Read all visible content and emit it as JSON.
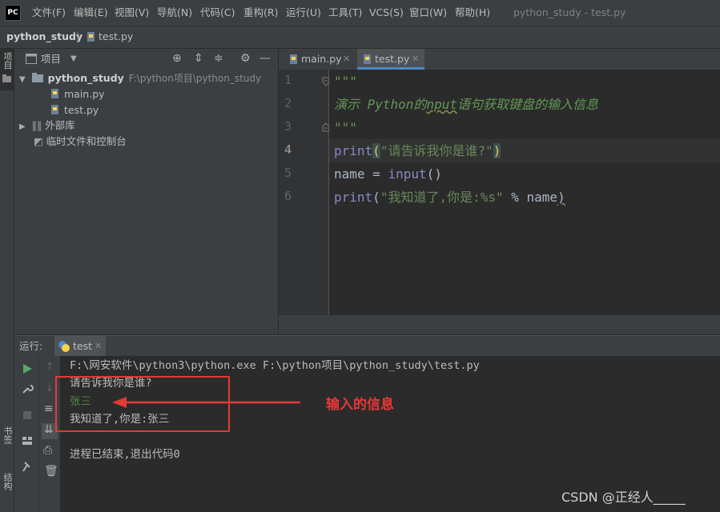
{
  "window": {
    "title": "python_study - test.py",
    "logo": "PC"
  },
  "menu": [
    "文件(F)",
    "编辑(E)",
    "视图(V)",
    "导航(N)",
    "代码(C)",
    "重构(R)",
    "运行(U)",
    "工具(T)",
    "VCS(S)",
    "窗口(W)",
    "帮助(H)"
  ],
  "breadcrumb": {
    "project": "python_study",
    "sep": "〉",
    "file": "test.py"
  },
  "sidebar_left": {
    "project_label": "项目",
    "bookmarks_label": "书签",
    "structure_label": "结构"
  },
  "project_panel": {
    "title": "项目",
    "tree": {
      "root": {
        "name": "python_study",
        "path": "F:\\python项目\\python_study"
      },
      "files": [
        "main.py",
        "test.py"
      ],
      "external_libs": "外部库",
      "scratches": "临时文件和控制台"
    }
  },
  "editor": {
    "tabs": [
      {
        "label": "main.py",
        "active": false
      },
      {
        "label": "test.py",
        "active": true
      }
    ],
    "line_numbers": [
      "1",
      "2",
      "3",
      "4",
      "5",
      "6"
    ],
    "lines": {
      "l1": "\"\"\"",
      "l2_a": "演示 ",
      "l2_b": "Python",
      "l2_c": "的",
      "l2_d": "nput",
      "l2_e": "语句获取键盘的输入信息",
      "l3": "\"\"\"",
      "l4_fn": "print",
      "l4_p1": "(",
      "l4_str": "\"请告诉我你是谁?\"",
      "l4_p2": ")",
      "l5_a": "name = ",
      "l5_fn": "input",
      "l5_b": "()",
      "l6_fn": "print",
      "l6_p1": "(",
      "l6_str": "\"我知道了,你是:%s\"",
      "l6_b": " % name",
      "l6_p2": ")"
    }
  },
  "run_panel": {
    "label": "运行:",
    "tab": "test",
    "output": {
      "cmd": "F:\\网安软件\\python3\\python.exe F:\\python项目\\python_study\\test.py",
      "prompt": "请告诉我你是谁?",
      "input": "张三",
      "result": "我知道了,你是:张三",
      "exit": "进程已结束,退出代码0"
    }
  },
  "annotation": {
    "text": "输入的信息",
    "color": "#e53935"
  },
  "watermark": "CSDN @正经人_____",
  "colors": {
    "keyword": "#8888c6",
    "string": "#6a8759",
    "docstring": "#629755",
    "input_text": "#4e8a3e",
    "accent": "#4a88c7"
  }
}
